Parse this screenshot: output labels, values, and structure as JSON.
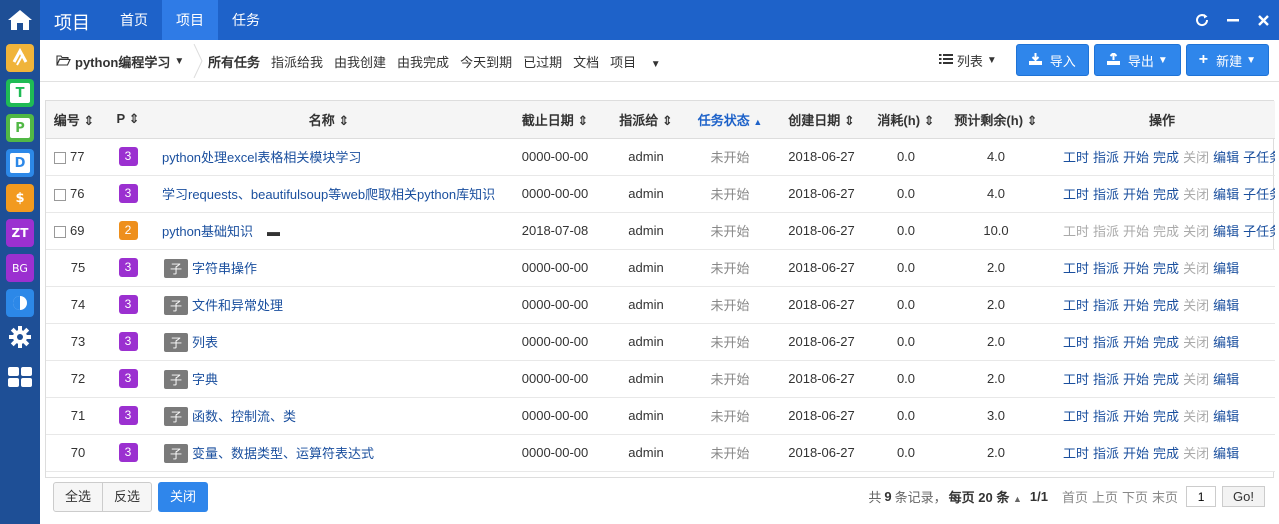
{
  "launcher": {
    "apps": [
      {
        "name": "home",
        "glyph": "⌂",
        "color": "#1e4f96"
      },
      {
        "name": "S",
        "glyph": "S",
        "color": "#f0b43a"
      },
      {
        "name": "T",
        "glyph": "T",
        "color": "#1fbb55"
      },
      {
        "name": "P",
        "glyph": "P",
        "color": "#51b845"
      },
      {
        "name": "D",
        "glyph": "D",
        "color": "#2c88e8"
      },
      {
        "name": "$",
        "glyph": "$",
        "color": "#f29a1f"
      },
      {
        "name": "ZT",
        "glyph": "ZT",
        "color": "#9b30d0"
      },
      {
        "name": "BG",
        "glyph": "BG",
        "color": "#9b30d0"
      },
      {
        "name": "C",
        "glyph": "C",
        "color": "#2c88e8"
      }
    ]
  },
  "topbar": {
    "app_name": "项目",
    "nav": [
      "首页",
      "项目",
      "任务"
    ],
    "active_nav": "项目"
  },
  "subnav": {
    "product": "python编程学习",
    "links": [
      "所有任务",
      "指派给我",
      "由我创建",
      "由我完成",
      "今天到期",
      "已过期",
      "文档",
      "项目"
    ],
    "view": "列表",
    "import_label": "导入",
    "export_label": "导出",
    "new_label": "新建"
  },
  "table": {
    "headers": {
      "id": "编号",
      "pri": "P",
      "name": "名称",
      "deadline": "截止日期",
      "assign": "指派给",
      "status": "任务状态",
      "created": "创建日期",
      "consumed": "消耗(h)",
      "left": "预计剩余(h)",
      "actions": "操作"
    },
    "rows": [
      {
        "id": "77",
        "pri": "3",
        "name": "python处理excel表格相关模块学习",
        "deadline": "0000-00-00",
        "assign": "admin",
        "status": "未开始",
        "created": "2018-06-27",
        "consumed": "0.0",
        "left": "4.0",
        "child": false,
        "parent": false
      },
      {
        "id": "76",
        "pri": "3",
        "name": "学习requests、beautifulsoup等web爬取相关python库知识",
        "deadline": "0000-00-00",
        "assign": "admin",
        "status": "未开始",
        "created": "2018-06-27",
        "consumed": "0.0",
        "left": "4.0",
        "child": false,
        "parent": false
      },
      {
        "id": "69",
        "pri": "2",
        "name": "python基础知识",
        "deadline": "2018-07-08",
        "assign": "admin",
        "status": "未开始",
        "created": "2018-06-27",
        "consumed": "0.0",
        "left": "10.0",
        "child": false,
        "parent": true
      },
      {
        "id": "75",
        "pri": "3",
        "name": "字符串操作",
        "deadline": "0000-00-00",
        "assign": "admin",
        "status": "未开始",
        "created": "2018-06-27",
        "consumed": "0.0",
        "left": "2.0",
        "child": true
      },
      {
        "id": "74",
        "pri": "3",
        "name": "文件和异常处理",
        "deadline": "0000-00-00",
        "assign": "admin",
        "status": "未开始",
        "created": "2018-06-27",
        "consumed": "0.0",
        "left": "2.0",
        "child": true
      },
      {
        "id": "73",
        "pri": "3",
        "name": "列表",
        "deadline": "0000-00-00",
        "assign": "admin",
        "status": "未开始",
        "created": "2018-06-27",
        "consumed": "0.0",
        "left": "2.0",
        "child": true
      },
      {
        "id": "72",
        "pri": "3",
        "name": "字典",
        "deadline": "0000-00-00",
        "assign": "admin",
        "status": "未开始",
        "created": "2018-06-27",
        "consumed": "0.0",
        "left": "2.0",
        "child": true
      },
      {
        "id": "71",
        "pri": "3",
        "name": "函数、控制流、类",
        "deadline": "0000-00-00",
        "assign": "admin",
        "status": "未开始",
        "created": "2018-06-27",
        "consumed": "0.0",
        "left": "3.0",
        "child": true
      },
      {
        "id": "70",
        "pri": "3",
        "name": "变量、数据类型、运算符表达式",
        "deadline": "0000-00-00",
        "assign": "admin",
        "status": "未开始",
        "created": "2018-06-27",
        "consumed": "0.0",
        "left": "2.0",
        "child": true
      }
    ],
    "subtask_tag": "子",
    "actions": {
      "hours": "工时",
      "assign": "指派",
      "start": "开始",
      "finish": "完成",
      "close": "关闭",
      "edit": "编辑",
      "subtask": "子任务"
    }
  },
  "footer": {
    "select_all": "全选",
    "invert": "反选",
    "close": "关闭",
    "pager": {
      "total_prefix": "共",
      "total": "9",
      "total_suffix": "条记录，",
      "per_prefix": "每页",
      "per": "20",
      "per_suffix": "条",
      "page": "1/1",
      "first": "首页",
      "prev": "上页",
      "next": "下页",
      "last": "末页",
      "input": "1",
      "go": "Go!"
    }
  }
}
